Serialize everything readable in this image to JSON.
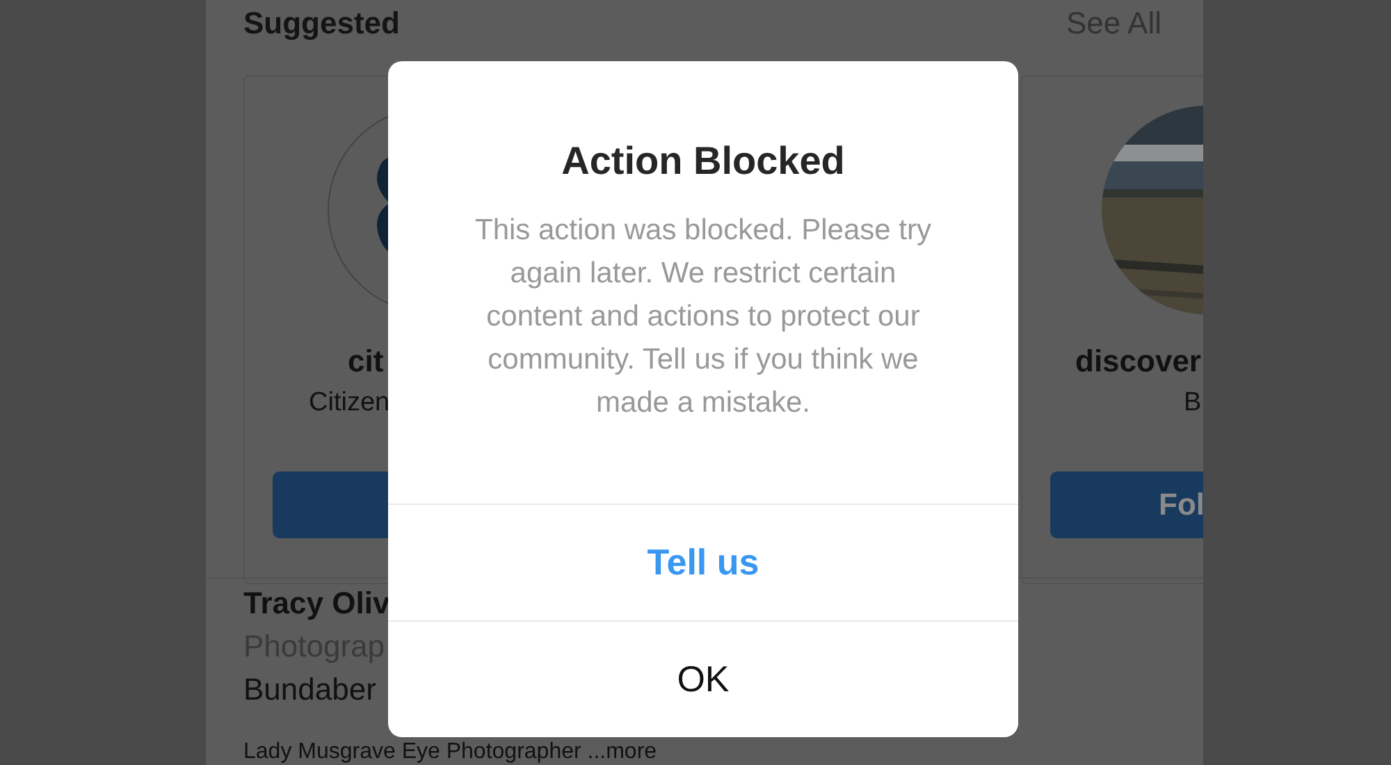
{
  "header": {
    "title": "Suggested",
    "link": "See All"
  },
  "suggestions": [
    {
      "name": "cit",
      "subtitle": "Citizen"
    },
    {
      "name": "discover",
      "subtitle": "B",
      "button": {
        "label": "Fol"
      }
    }
  ],
  "profile": {
    "name": "Tracy Oliv",
    "category": "Photograp",
    "lines": [
      "Bundaber",
      "Lady Musgrave Eye Photographer ...more"
    ]
  },
  "dialog": {
    "title": "Action Blocked",
    "message": "This action was blocked. Please try again later. We restrict certain content and actions to protect our community. Tell us if you think we made a mistake.",
    "actions": [
      {
        "label": "Tell us",
        "kind": "primary"
      },
      {
        "label": "OK",
        "kind": "plain"
      }
    ]
  }
}
